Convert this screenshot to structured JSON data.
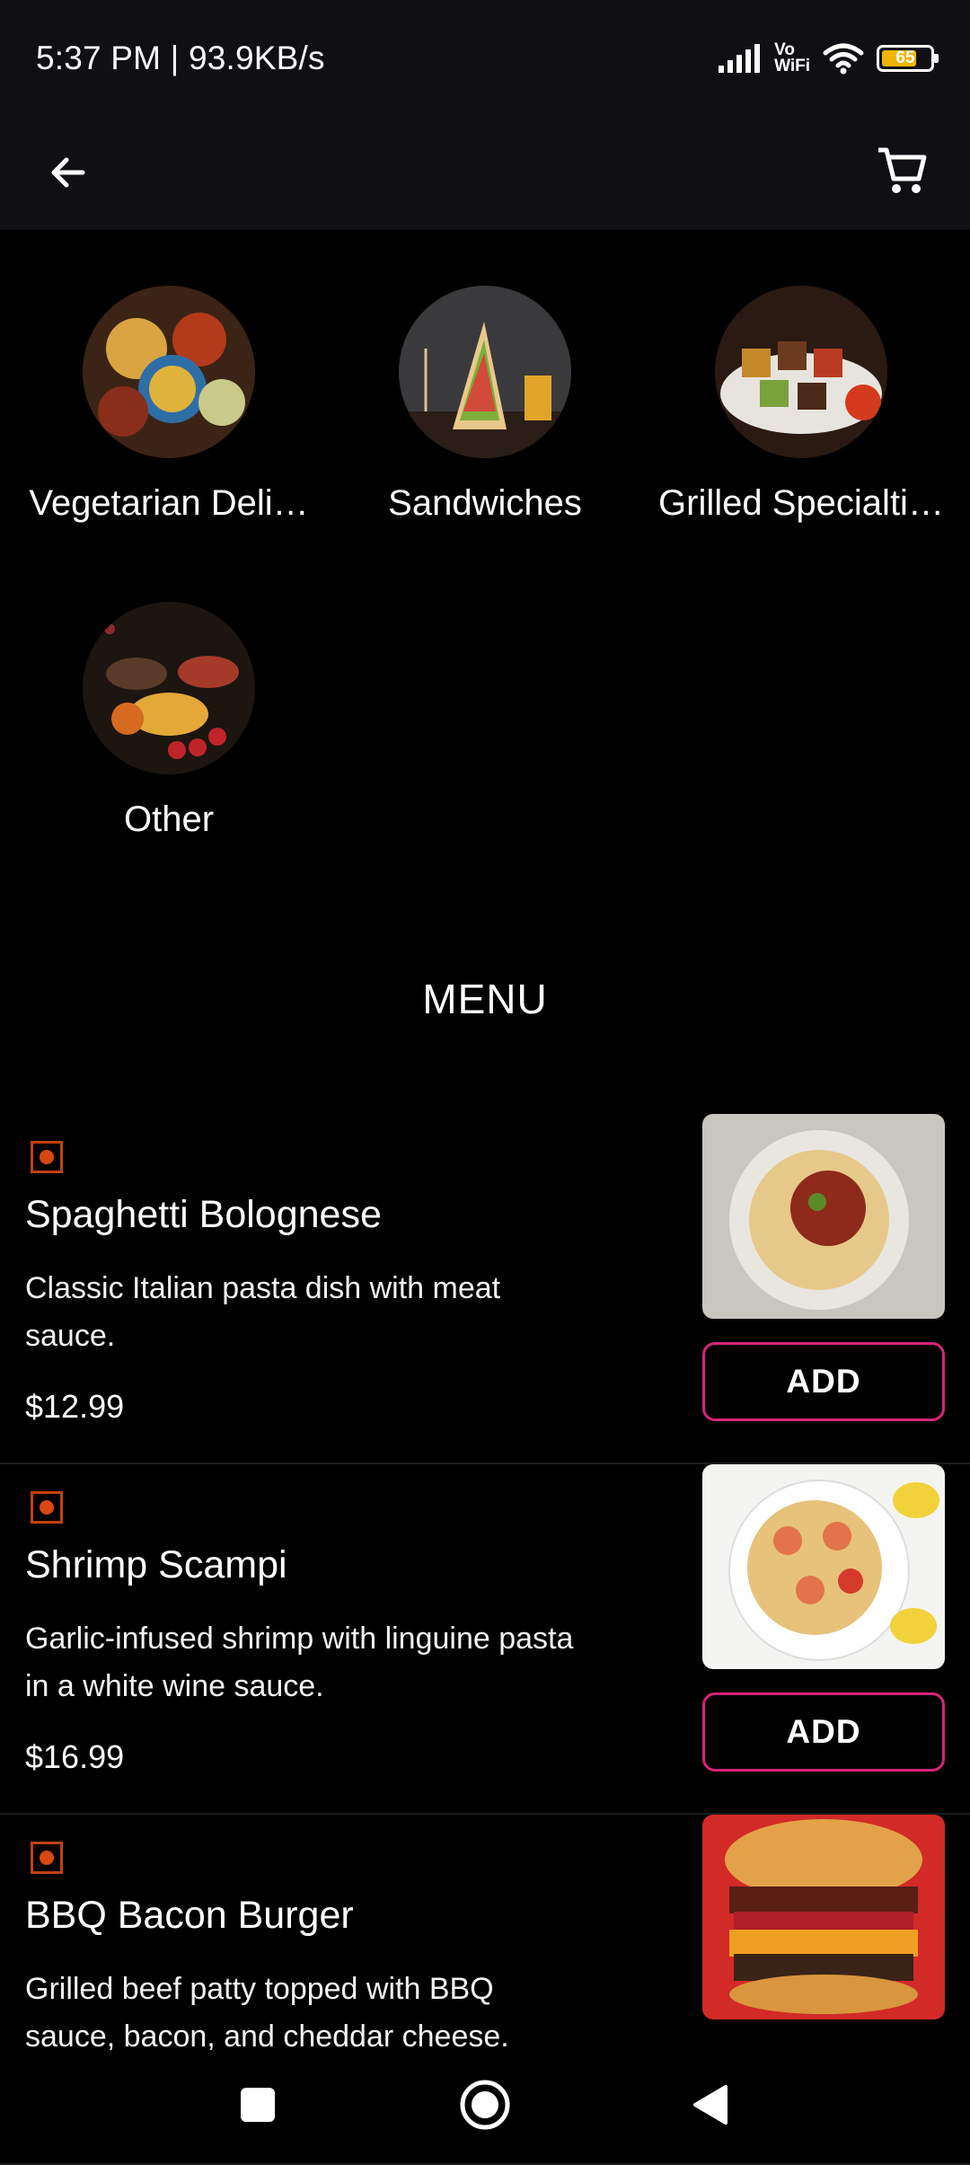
{
  "status_bar": {
    "time_speed": "5:37 PM | 93.9KB/s",
    "vowifi_line1": "Vo",
    "vowifi_line2": "WiFi",
    "battery_level": "65"
  },
  "topbar": {
    "back_icon": "arrow-left-icon",
    "cart_icon": "cart-icon"
  },
  "categories": [
    {
      "label": "Vegetarian Deli…",
      "image": "vegetarian-thali-image"
    },
    {
      "label": "Sandwiches",
      "image": "club-sandwich-image"
    },
    {
      "label": "Grilled Specialti…",
      "image": "grilled-skewers-image"
    },
    {
      "label": "Other",
      "image": "festive-dishes-image"
    }
  ],
  "menu": {
    "title": "MENU",
    "add_label": "ADD",
    "items": [
      {
        "name": "Spaghetti Bolognese",
        "description": "Classic Italian pasta dish with meat sauce.",
        "price": "$12.99",
        "image": "spaghetti-image"
      },
      {
        "name": "Shrimp Scampi",
        "description": "Garlic-infused shrimp with linguine pasta in a white wine sauce.",
        "price": "$16.99",
        "image": "shrimp-pasta-image"
      },
      {
        "name": "BBQ Bacon Burger",
        "description": "Grilled beef patty topped with BBQ sauce, bacon, and cheddar cheese.",
        "price": "",
        "image": "burger-image"
      }
    ]
  },
  "colors": {
    "accent_border": "#d6247a",
    "veg_mark": "#c2410c",
    "bar_bg": "#100f14",
    "battery_fill": "#f0b400"
  },
  "navigation": {
    "recents_icon": "square-recents-icon",
    "home_icon": "circle-home-icon",
    "back_icon": "triangle-back-icon"
  }
}
